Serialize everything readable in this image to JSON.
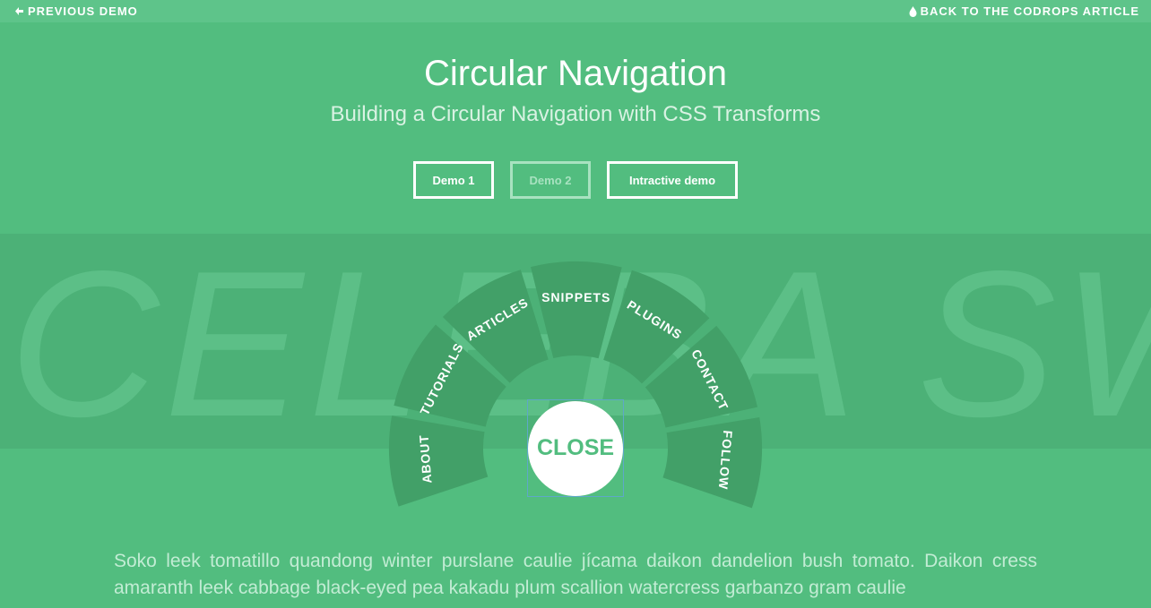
{
  "topbar": {
    "previous_demo": "PREVIOUS DEMO",
    "back_to_article": "BACK TO THE CODROPS ARTICLE"
  },
  "header": {
    "title": "Circular Navigation",
    "subtitle": "Building a Circular Navigation with CSS Transforms"
  },
  "demos": [
    {
      "label": "Demo 1",
      "active": false
    },
    {
      "label": "Demo 2",
      "active": true
    },
    {
      "label": "Intractive demo",
      "active": false
    }
  ],
  "watermark": "CELEBA SWIS",
  "circular_nav": {
    "items": [
      "ABOUT",
      "TUTORIALS",
      "ARTICLES",
      "SNIPPETS",
      "PLUGINS",
      "CONTACT",
      "FOLLOW"
    ],
    "close_label": "CLOSE"
  },
  "body_text": "Soko leek tomatillo quandong winter purslane caulie jícama daikon dandelion bush tomato. Daikon cress amaranth leek cabbage black-eyed pea kakadu plum scallion watercress garbanzo gram caulie",
  "colors": {
    "background": "#52bd7f",
    "band": "#4cb177",
    "segment": "#42a068",
    "close_text": "#52bd7f"
  }
}
